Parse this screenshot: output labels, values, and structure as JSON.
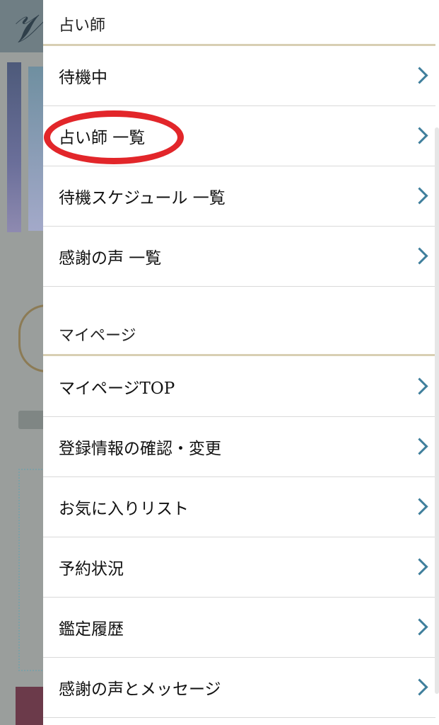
{
  "colors": {
    "chevron": "#3f7f9c",
    "section_rule": "#d8cfb3",
    "highlight": "#e2262a"
  },
  "sections": [
    {
      "title": "占い師",
      "items": [
        {
          "label": "待機中",
          "icon": "chevron-right-icon"
        },
        {
          "label": "占い師 一覧",
          "icon": "chevron-right-icon",
          "highlighted": true
        },
        {
          "label": "待機スケジュール 一覧",
          "icon": "chevron-right-icon"
        },
        {
          "label": "感謝の声 一覧",
          "icon": "chevron-right-icon"
        }
      ]
    },
    {
      "title": "マイページ",
      "items": [
        {
          "label": "マイページTOP",
          "icon": "chevron-right-icon"
        },
        {
          "label": "登録情報の確認・変更",
          "icon": "chevron-right-icon"
        },
        {
          "label": "お気に入りリスト",
          "icon": "chevron-right-icon"
        },
        {
          "label": "予約状況",
          "icon": "chevron-right-icon"
        },
        {
          "label": "鑑定履歴",
          "icon": "chevron-right-icon"
        },
        {
          "label": "感謝の声とメッセージ",
          "icon": "chevron-right-icon"
        }
      ]
    }
  ]
}
